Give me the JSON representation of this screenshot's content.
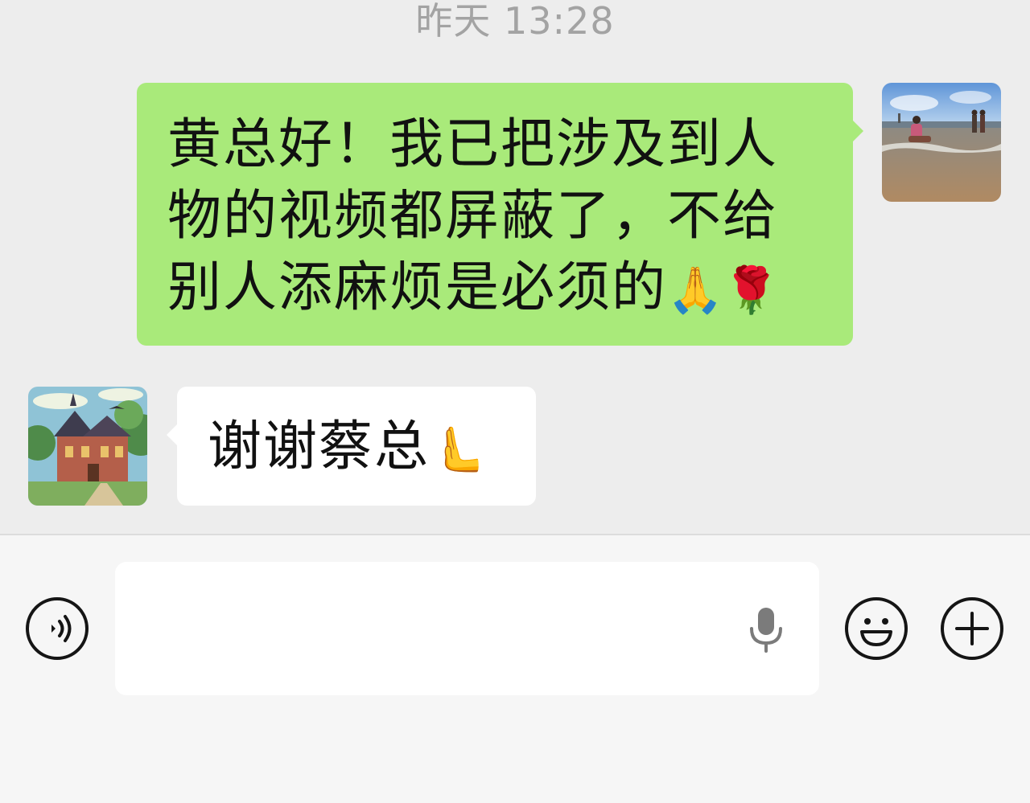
{
  "chat": {
    "timestamp": "昨天 13:28",
    "messages": [
      {
        "direction": "outgoing",
        "text": "黄总好！我已把涉及到人物的视频都屏蔽了，不给别人添麻烦是必须的",
        "emoji": "🙏🌹"
      },
      {
        "direction": "incoming",
        "text": "谢谢蔡总",
        "emoji": "🫷"
      }
    ]
  },
  "colors": {
    "outgoing_bubble": "#a9ea7a",
    "incoming_bubble": "#ffffff",
    "chat_background": "#ededed",
    "input_bar_background": "#f6f6f6"
  },
  "input_bar": {
    "icons": [
      "voice-icon",
      "mic-icon",
      "emoji-icon",
      "plus-icon"
    ],
    "value": ""
  }
}
